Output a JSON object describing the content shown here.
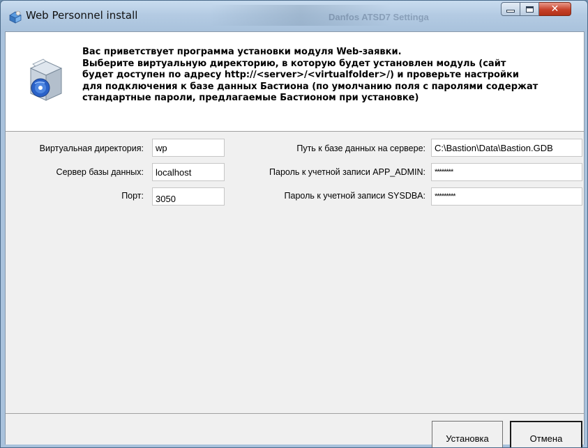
{
  "window": {
    "title": "Web Personnel install",
    "background_blur_text": "Danfos ATSD7 Settinga"
  },
  "header": {
    "lines": [
      "Вас приветствует программа установки модуля Web-заявки.",
      "Выберите виртуальную директорию, в которую будет установлен модуль (сайт",
      "будет доступен по адресу http://<server>/<virtualfolder>/) и проверьте настройки",
      "для подключения к базе данных Бастиона (по умолчанию поля с паролями содержат",
      "стандартные пароли, предлагаемые Бастионом при установке)"
    ],
    "icon": "installer-box-icon"
  },
  "form": {
    "virtual_dir": {
      "label": "Виртуальная директория:",
      "value": "wp"
    },
    "db_server": {
      "label": "Сервер базы данных:",
      "value": "localhost"
    },
    "port": {
      "label": "Порт:",
      "value": "3050"
    },
    "db_path": {
      "label": "Путь к базе данных на сервере:",
      "value": "C:\\Bastion\\Data\\Bastion.GDB"
    },
    "app_admin_password": {
      "label": "Пароль к учетной записи APP_ADMIN:",
      "value": "********"
    },
    "sysdba_password": {
      "label": "Пароль к учетной записи SYSDBA:",
      "value": "*********"
    }
  },
  "buttons": {
    "install": "Установка",
    "cancel": "Отмена"
  },
  "colors": {
    "title_gradient_top": "#c9dcef",
    "close_button": "#c6412a",
    "client_bg": "#f0f0f0"
  }
}
